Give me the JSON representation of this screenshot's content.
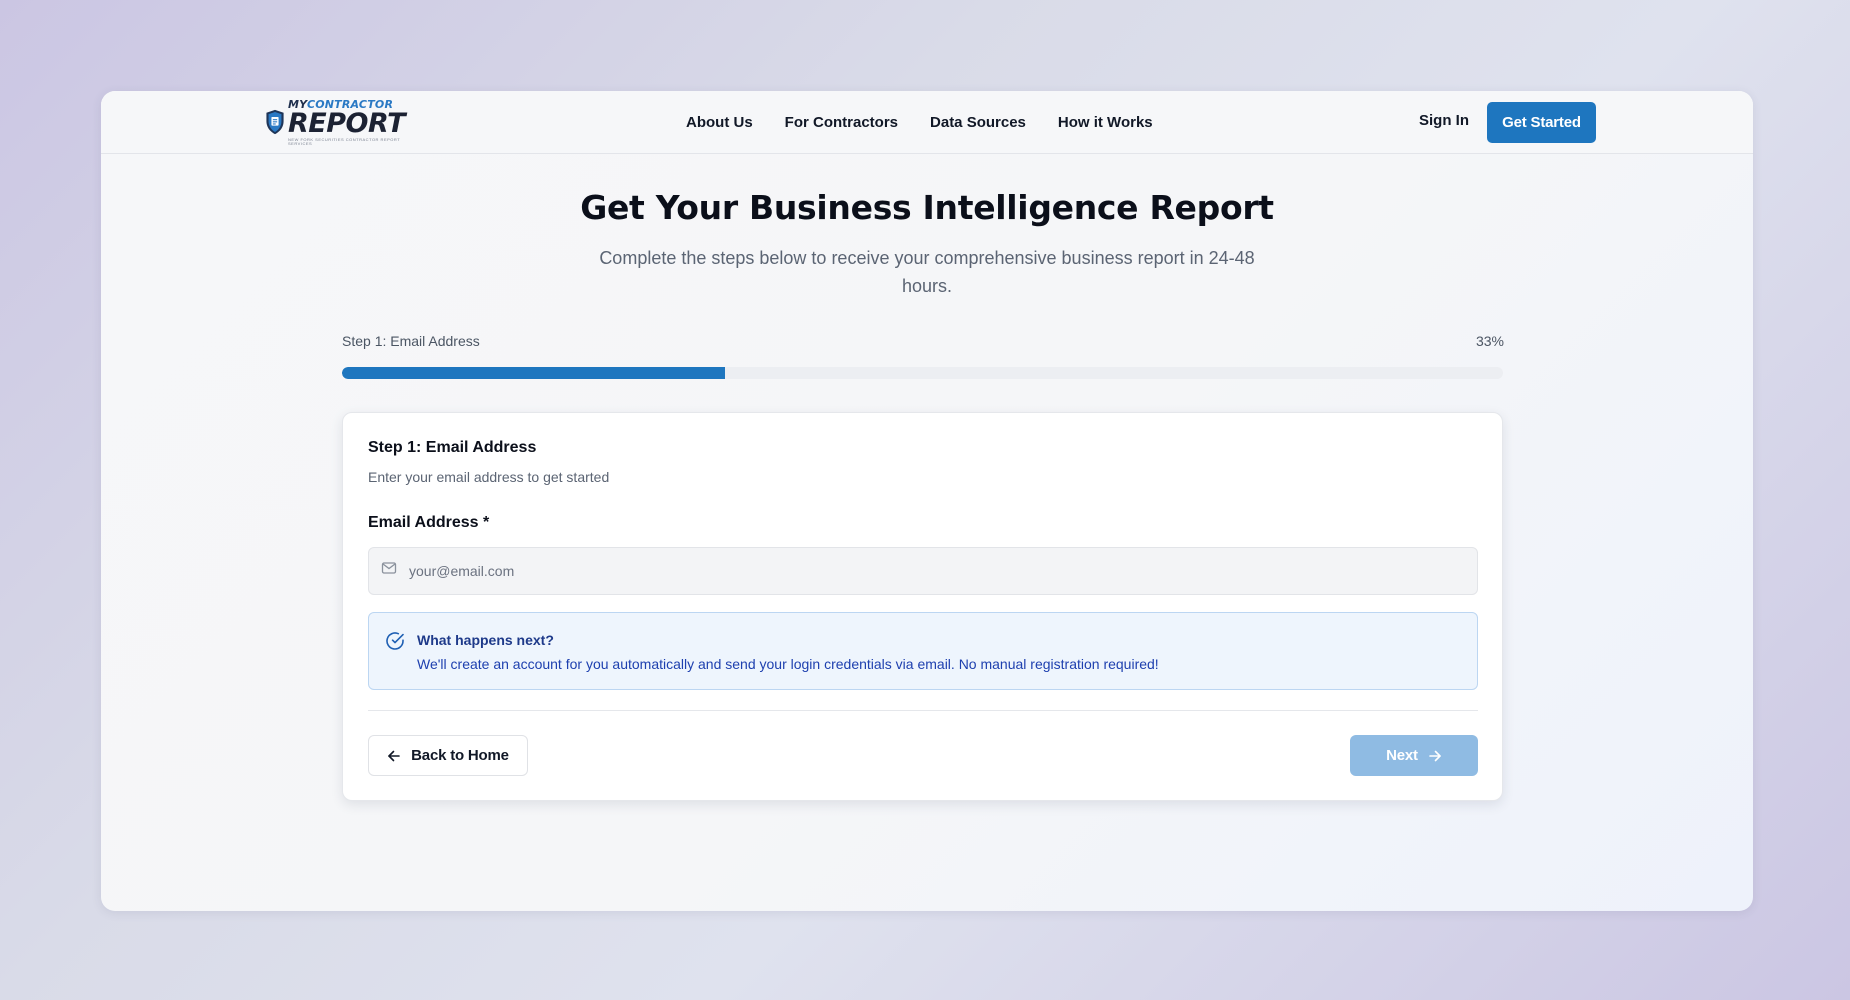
{
  "brand": {
    "logo_top_prefix": "MY",
    "logo_top_accent": "CONTRACTOR",
    "logo_main": "REPORT",
    "logo_tagline": "NEW FORK SECURITIES CONTRACTOR REPORT SERVICES"
  },
  "nav": {
    "links": [
      "About Us",
      "For Contractors",
      "Data Sources",
      "How it Works"
    ],
    "sign_in": "Sign In",
    "get_started": "Get Started"
  },
  "hero": {
    "title": "Get Your Business Intelligence Report",
    "subtitle": "Complete the steps below to receive your comprehensive business report in 24-48 hours."
  },
  "progress": {
    "label": "Step 1: Email Address",
    "percent_text": "33%",
    "fraction": 0.33
  },
  "form": {
    "step_title": "Step 1: Email Address",
    "step_subtitle": "Enter your email address to get started",
    "email_label": "Email Address *",
    "email_value": "",
    "email_placeholder": "your@email.com",
    "info_title": "What happens next?",
    "info_text": "We'll create an account for you automatically and send your login credentials via email. No manual registration required!",
    "back_label": "Back to Home",
    "next_label": "Next"
  },
  "icons": {
    "logo": "shield-logo-icon",
    "email": "mail-icon",
    "info": "check-circle-icon",
    "back": "arrow-left-icon",
    "next": "arrow-right-icon"
  },
  "colors": {
    "accent": "#1e76bf",
    "next_disabled": "#8fbbe3",
    "info_bg": "#eef5fd",
    "info_border": "#bcd6f2"
  }
}
